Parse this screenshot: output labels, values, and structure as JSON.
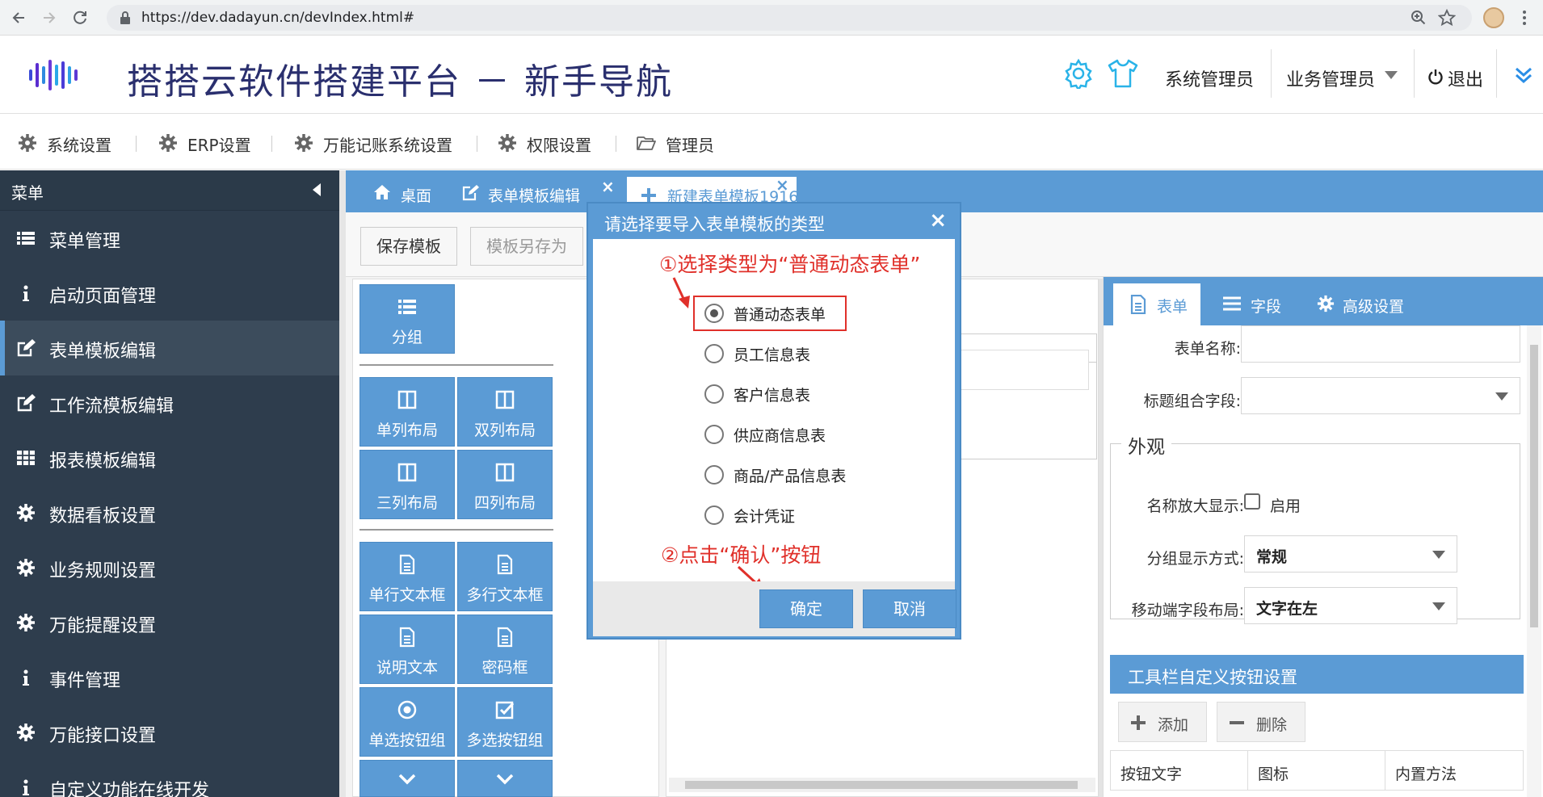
{
  "browser": {
    "url": "https://dev.dadayun.cn/devIndex.html#"
  },
  "header": {
    "title": "搭搭云软件搭建平台 － 新手导航",
    "user_role": "系统管理员",
    "business_role": "业务管理员",
    "logout": "退出"
  },
  "top_menu": [
    {
      "label": "系统设置",
      "icon": "gear-icon"
    },
    {
      "label": "ERP设置",
      "icon": "gear-icon"
    },
    {
      "label": "万能记账系统设置",
      "icon": "gear-icon"
    },
    {
      "label": "权限设置",
      "icon": "gear-icon"
    },
    {
      "label": "管理员",
      "icon": "folder-open-icon"
    }
  ],
  "sidebar": {
    "title": "菜单",
    "items": [
      {
        "label": "菜单管理",
        "icon": "list-icon"
      },
      {
        "label": "启动页面管理",
        "icon": "info-icon"
      },
      {
        "label": "表单模板编辑",
        "icon": "edit-icon",
        "active": true
      },
      {
        "label": "工作流模板编辑",
        "icon": "edit-icon"
      },
      {
        "label": "报表模板编辑",
        "icon": "table-icon"
      },
      {
        "label": "数据看板设置",
        "icon": "gear-icon"
      },
      {
        "label": "业务规则设置",
        "icon": "gear-icon"
      },
      {
        "label": "万能提醒设置",
        "icon": "gear-icon"
      },
      {
        "label": "事件管理",
        "icon": "info-icon"
      },
      {
        "label": "万能接口设置",
        "icon": "gear-icon"
      },
      {
        "label": "自定义功能在线开发",
        "icon": "info-icon"
      }
    ]
  },
  "tabs": [
    {
      "label": "桌面",
      "icon": "home-icon"
    },
    {
      "label": "表单模板编辑",
      "icon": "edit-icon"
    },
    {
      "label": "新建表单模板1916",
      "icon": "plus-icon"
    }
  ],
  "toolbar": {
    "save": "保存模板",
    "save_as": "模板另存为"
  },
  "palette": {
    "group": "分组",
    "items": [
      "单列布局",
      "双列布局",
      "三列布局",
      "四列布局",
      "单行文本框",
      "多行文本框",
      "说明文本",
      "密码框",
      "单选按钮组",
      "多选按钮组"
    ]
  },
  "right_panel": {
    "tabs": [
      "表单",
      "字段",
      "高级设置"
    ],
    "form_name_label": "表单名称:",
    "title_field_label": "标题组合字段:",
    "appearance_legend": "外观",
    "enlarge_label": "名称放大显示:",
    "enlarge_option": "启用",
    "group_display_label": "分组显示方式:",
    "group_display_value": "常规",
    "mobile_layout_label": "移动端字段布局:",
    "mobile_layout_value": "文字在左",
    "toolbar_section": "工具栏自定义按钮设置",
    "add": "添加",
    "delete": "删除",
    "columns": [
      "按钮文字",
      "图标",
      "内置方法"
    ]
  },
  "dialog": {
    "title": "请选择要导入表单模板的类型",
    "annotation1": "①选择类型为“普通动态表单”",
    "annotation2": "②点击“确认”按钮",
    "options": [
      "普通动态表单",
      "员工信息表",
      "客户信息表",
      "供应商信息表",
      "商品/产品信息表",
      "会计凭证"
    ],
    "selected": "普通动态表单",
    "confirm": "确定",
    "cancel": "取消"
  },
  "colors": {
    "accent": "#5b9bd5",
    "sidebar_bg": "#2e3d4d",
    "annotation": "#e0302a",
    "title": "#2a2f6e"
  }
}
